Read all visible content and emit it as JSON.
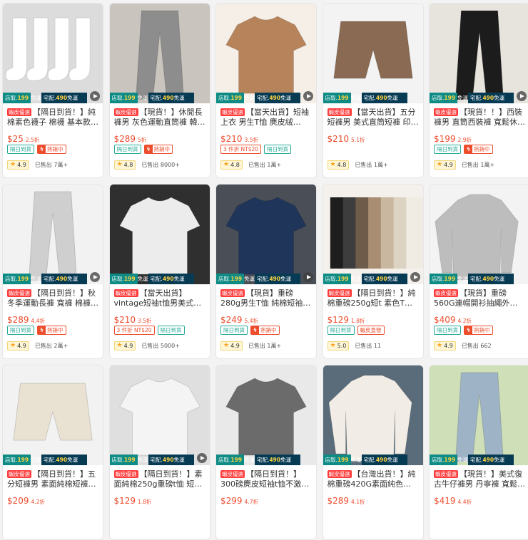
{
  "promo": {
    "pickup_label": "店取",
    "pickup_price": "199",
    "home_label": "宅配",
    "home_price": "490",
    "free_label": "免運"
  },
  "fast_badge": "蝦皮優選",
  "products": [
    {
      "title": "【隔日到貨！】純棉素色襪子 棉襪 基本款 黑…",
      "price": "$25",
      "discount": "2.5折",
      "tags": [
        {
          "text": "隔日到貨",
          "style": "green"
        },
        {
          "text": "熱銷中",
          "style": "hot"
        }
      ],
      "rating": "4.9",
      "sold": "已售出 7萬+",
      "image": "socks",
      "video": true
    },
    {
      "title": "【現貨！】休閒長褲男 灰色運動直筒褲 韓版…",
      "price": "$289",
      "discount": "5折",
      "tags": [
        {
          "text": "隔日到貨",
          "style": "green"
        },
        {
          "text": "熱銷中",
          "style": "hot"
        }
      ],
      "rating": "4.8",
      "sold": "已售出 8000+",
      "image": "grey_pants",
      "video": false
    },
    {
      "title": "【當天出貨】短袖上衣 男生T恤 麂皮絨oversiz…",
      "price": "$210",
      "discount": "3.5折",
      "tags": [
        {
          "text": "3 件折 NT$20",
          "style": "red"
        },
        {
          "text": "隔日到貨",
          "style": "green"
        }
      ],
      "rating": "4.8",
      "sold": "已售出 1萬+",
      "image": "suede_tee",
      "video": true
    },
    {
      "title": "【當天出貨】五分短褲男 美式直筒短褲 印花…",
      "price": "$210",
      "discount": "5.1折",
      "tags": [],
      "rating": "4.8",
      "sold": "已售出 1萬+",
      "image": "shorts_brown",
      "video": false
    },
    {
      "title": "【現貨！！】西裝褲男 直筒西裝褲 寬鬆休閒…",
      "price": "$199",
      "discount": "2.9折",
      "tags": [
        {
          "text": "隔日到貨",
          "style": "green"
        },
        {
          "text": "熱銷中",
          "style": "hot"
        }
      ],
      "rating": "4.9",
      "sold": "已售出 1萬+",
      "image": "black_pants",
      "video": true
    },
    {
      "title": "【隔日到貨！】秋冬季運動長褲 寬褲 棉褲 內…",
      "price": "$289",
      "discount": "4.4折",
      "tags": [
        {
          "text": "隔日到貨",
          "style": "green"
        },
        {
          "text": "熱銷中",
          "style": "hot"
        }
      ],
      "rating": "4.9",
      "sold": "已售出 2萬+",
      "image": "joggers",
      "video": true
    },
    {
      "title": "【當天出貨】vintage短袖t恤男美式復…",
      "price": "$210",
      "discount": "3.5折",
      "tags": [
        {
          "text": "3 件折 NT$20",
          "style": "red"
        },
        {
          "text": "隔日到貨",
          "style": "green"
        }
      ],
      "rating": "4.9",
      "sold": "已售出 5000+",
      "image": "emotion_tee",
      "video": false
    },
    {
      "title": "【現貨】重磅280g男生T恤 純棉短袖 日系短…",
      "price": "$249",
      "discount": "5.4折",
      "tags": [
        {
          "text": "隔日到貨",
          "style": "green"
        },
        {
          "text": "熱銷中",
          "style": "hot"
        }
      ],
      "rating": "4.9",
      "sold": "已售出 1萬+",
      "image": "navy_tee",
      "video": true
    },
    {
      "title": "【隔日到貨！】純棉重磅250g短t 素色T恤 男生…",
      "price": "$129",
      "discount": "1.8折",
      "tags": [
        {
          "text": "隔日到貨",
          "style": "green"
        },
        {
          "text": "蝦皮直營",
          "style": "red"
        }
      ],
      "rating": "5.0",
      "sold": "已售出 11",
      "image": "tees_rack",
      "video": true
    },
    {
      "title": "【現貨】重磅560G連帽開衫抽繩外套 簡約純…",
      "price": "$409",
      "discount": "4.2折",
      "tags": [
        {
          "text": "隔日到貨",
          "style": "green"
        },
        {
          "text": "熱銷中",
          "style": "hot"
        }
      ],
      "rating": "4.9",
      "sold": "已售出 662",
      "image": "hoodie",
      "video": false
    },
    {
      "title": "【隔日到貨！】五分短褲男 素面純棉短褲男…",
      "price": "$209",
      "discount": "4.2折",
      "tags": [],
      "rating": "",
      "sold": "",
      "image": "shorts_cream",
      "video": false
    },
    {
      "title": "【隔日到貨！】素面純棉250g重磅t恤 短袖t恤…",
      "price": "$129",
      "discount": "1.8折",
      "tags": [],
      "rating": "",
      "sold": "",
      "image": "white_tee",
      "video": true
    },
    {
      "title": "【隔日到貨！】300磅麂皮短袖t恤不激凸 男…",
      "price": "$299",
      "discount": "4.7折",
      "tags": [],
      "rating": "",
      "sold": "",
      "image": "grey_tee",
      "video": false
    },
    {
      "title": "【台灣出貨！】純棉重磅420G素面純色大…",
      "price": "$289",
      "discount": "4.1折",
      "tags": [],
      "rating": "",
      "sold": "",
      "image": "sweatshirt",
      "video": false
    },
    {
      "title": "【現貨！】美式復古牛仔褲男 丹寧褲 寬鬆…",
      "price": "$419",
      "discount": "4.4折",
      "tags": [],
      "rating": "",
      "sold": "",
      "image": "jeans",
      "video": false
    }
  ],
  "image_palette": {
    "socks": "#e9e9e9",
    "grey_pants": "#8d8d8d",
    "suede_tee": "#b7835a",
    "shorts_brown": "#8a6a52",
    "black_pants": "#1c1c1c",
    "joggers": "#cfcfcf",
    "emotion_tee": "#ececec",
    "navy_tee": "#20355a",
    "tees_rack": "#a08a73",
    "hoodie": "#bdbdbd",
    "shorts_cream": "#e9e2d3",
    "white_tee": "#f4f4f4",
    "grey_tee": "#6b6b6b",
    "sweatshirt": "#f1ede6",
    "jeans": "#9fb3c7"
  }
}
